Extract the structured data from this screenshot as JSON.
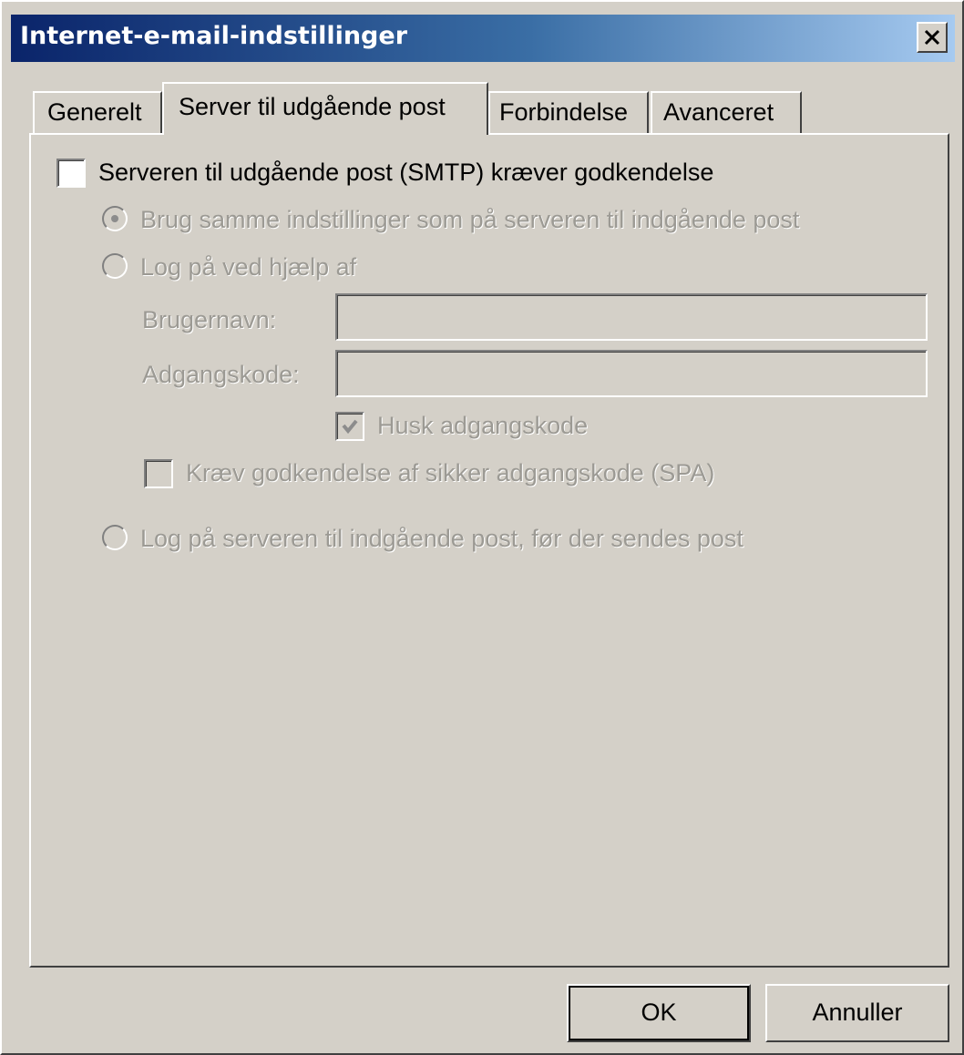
{
  "window": {
    "title": "Internet-e-mail-indstillinger"
  },
  "tabs": [
    {
      "label": "Generelt",
      "active": false
    },
    {
      "label": "Server til udgående post",
      "active": true
    },
    {
      "label": "Forbindelse",
      "active": false
    },
    {
      "label": "Avanceret",
      "active": false
    }
  ],
  "smtp_auth": {
    "label": "Serveren til udgående post (SMTP) kræver godkendelse",
    "checked": false
  },
  "options": {
    "same_settings": {
      "label": "Brug samme indstillinger som på serveren til indgående post",
      "selected": true,
      "enabled": false
    },
    "log_on_using": {
      "label": "Log på ved hjælp af",
      "selected": false,
      "enabled": false
    },
    "logon_before_send": {
      "label": "Log på serveren til indgående post, før der sendes post",
      "selected": false,
      "enabled": false
    }
  },
  "credentials": {
    "username_label": "Brugernavn:",
    "username_value": "",
    "password_label": "Adgangskode:",
    "password_value": "",
    "remember_label": "Husk adgangskode",
    "remember_checked": true,
    "spa_label": "Kræv godkendelse af sikker adgangskode (SPA)",
    "spa_checked": false
  },
  "buttons": {
    "ok": "OK",
    "cancel": "Annuller"
  },
  "colors": {
    "dialog_bg": "#d4d0c8",
    "title_gradient_start": "#0a246a",
    "title_gradient_end": "#a6caf0",
    "disabled_text": "#9c9a94"
  }
}
